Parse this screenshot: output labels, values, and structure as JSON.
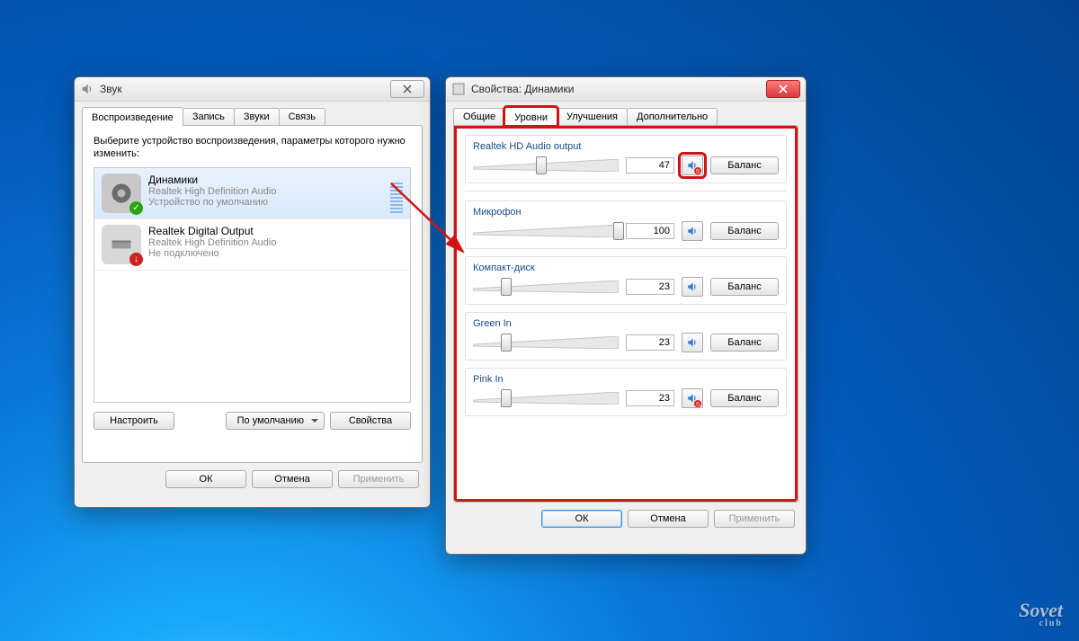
{
  "sound": {
    "title": "Звук",
    "tabs": [
      "Воспроизведение",
      "Запись",
      "Звуки",
      "Связь"
    ],
    "selected_tab": 0,
    "instruction": "Выберите устройство воспроизведения, параметры которого нужно изменить:",
    "devices": [
      {
        "name": "Динамики",
        "desc1": "Realtek High Definition Audio",
        "desc2": "Устройство по умолчанию",
        "status": "ok",
        "selected": true
      },
      {
        "name": "Realtek Digital Output",
        "desc1": "Realtek High Definition Audio",
        "desc2": "Не подключено",
        "status": "off",
        "selected": false
      }
    ],
    "btn_configure": "Настроить",
    "btn_default": "По умолчанию",
    "btn_properties": "Свойства",
    "btn_ok": "ОК",
    "btn_cancel": "Отмена",
    "btn_apply": "Применить"
  },
  "props": {
    "title": "Свойства: Динамики",
    "tabs": [
      "Общие",
      "Уровни",
      "Улучшения",
      "Дополнительно"
    ],
    "selected_tab": 1,
    "levels": [
      {
        "name": "Realtek HD Audio output",
        "value": "47",
        "pct": 47,
        "muted": true
      },
      {
        "name": "Микрофон",
        "value": "100",
        "pct": 100,
        "muted": false
      },
      {
        "name": "Компакт-диск",
        "value": "23",
        "pct": 23,
        "muted": false
      },
      {
        "name": "Green In",
        "value": "23",
        "pct": 23,
        "muted": false
      },
      {
        "name": "Pink In",
        "value": "23",
        "pct": 23,
        "muted": true
      }
    ],
    "btn_balance": "Баланс",
    "btn_ok": "ОК",
    "btn_cancel": "Отмена",
    "btn_apply": "Применить"
  },
  "watermark": {
    "top": "Sovet",
    "sub": "club"
  }
}
